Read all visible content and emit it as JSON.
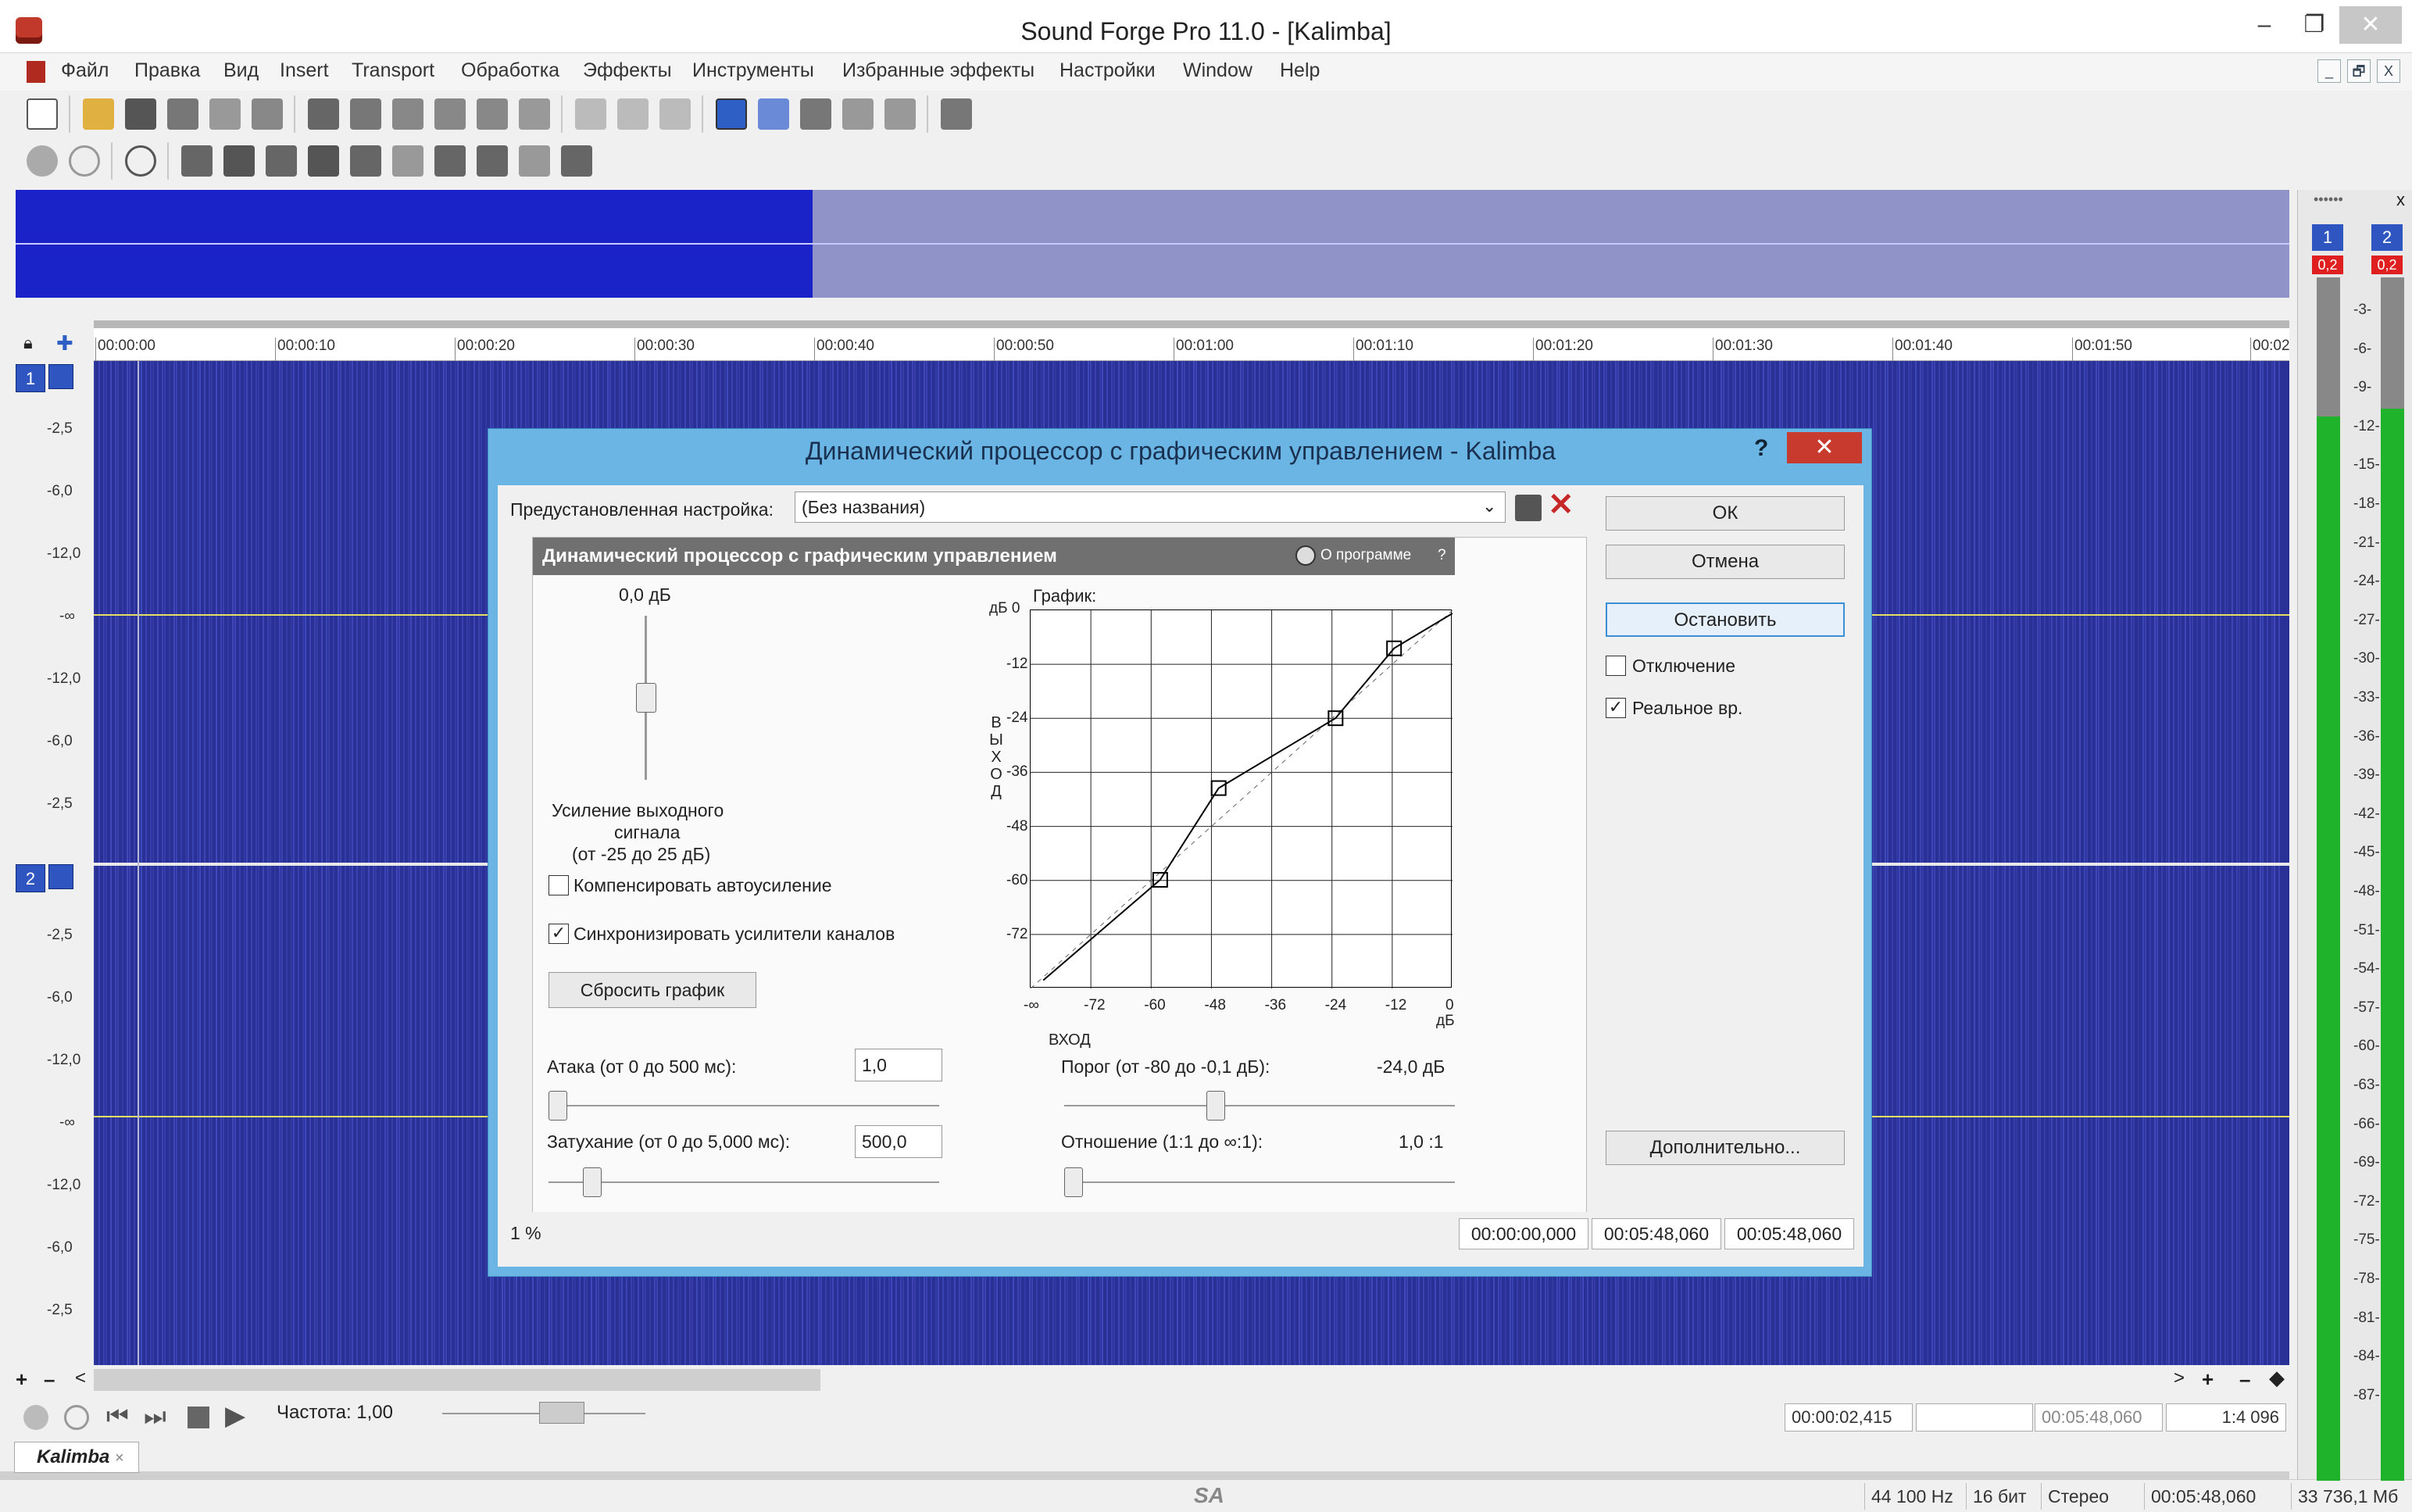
{
  "window": {
    "title": "Sound Forge Pro 11.0 - [Kalimba]",
    "minimize": "–",
    "restore": "❐",
    "close": "✕"
  },
  "menu": [
    "Файл",
    "Правка",
    "Вид",
    "Insert",
    "Transport",
    "Обработка",
    "Эффекты",
    "Инструменты",
    "Избранные эффекты",
    "Настройки",
    "Window",
    "Help"
  ],
  "mdi_buttons": [
    "_",
    "🗗",
    "X"
  ],
  "ruler": [
    "00:00:00",
    "00:00:10",
    "00:00:20",
    "00:00:30",
    "00:00:40",
    "00:00:50",
    "00:01:00",
    "00:01:10",
    "00:01:20",
    "00:01:30",
    "00:01:40",
    "00:01:50",
    "00:02"
  ],
  "channels": [
    {
      "badge": "1",
      "db_labels": [
        "-2,5",
        "-6,0",
        "-12,0",
        "-∞",
        "-12,0",
        "-6,0",
        "-2,5"
      ]
    },
    {
      "badge": "2",
      "db_labels": [
        "-2,5",
        "-6,0",
        "-12,0",
        "-∞",
        "-12,0",
        "-6,0",
        "-2,5"
      ]
    }
  ],
  "transport": {
    "rate_label": "Частота: 1,00"
  },
  "bottom_fields": {
    "position": "00:00:02,415",
    "length": "00:05:48,060",
    "zoom": "1:4 096"
  },
  "document_tab": {
    "name": "Kalimba",
    "close": "×"
  },
  "status": {
    "logo": "SA",
    "sample_rate": "44 100 Hz",
    "bits": "16 бит",
    "channels": "Стерео",
    "duration": "00:05:48,060",
    "size": "33 736,1 Мб"
  },
  "meter": {
    "ch1": "1",
    "ch2": "2",
    "peak1": "0,2",
    "peak2": "0,2",
    "close": "x",
    "scale": [
      "3",
      "6",
      "9",
      "12",
      "15",
      "18",
      "21",
      "24",
      "27",
      "30",
      "33",
      "36",
      "39",
      "42",
      "45",
      "48",
      "51",
      "54",
      "57",
      "60",
      "63",
      "66",
      "69",
      "72",
      "75",
      "78",
      "81",
      "84",
      "87"
    ]
  },
  "dialog": {
    "title": "Динамический процессор с графическим управлением - Kalimba",
    "help": "?",
    "close": "✕",
    "preset_label": "Предустановленная настройка:",
    "preset_value": "(Без названия)",
    "ok": "ОК",
    "cancel": "Отмена",
    "stop": "Остановить",
    "bypass": "Отключение",
    "realtime": "Реальное вр.",
    "more": "Дополнительно...",
    "progress": "1 %",
    "time_start": "00:00:00,000",
    "time_end": "00:05:48,060",
    "time_length": "00:05:48,060",
    "plugin": {
      "title": "Динамический процессор с графическим управлением",
      "about": "О программе",
      "about_q": "?",
      "gain_value": "0,0 дБ",
      "gain_label_1": "Усиление выходного",
      "gain_label_2": "сигнала",
      "gain_label_3": "(от -25 до 25 дБ)",
      "auto_gain": "Компенсировать автоусиление",
      "sync_gain": "Синхронизировать усилители каналов",
      "reset": "Сбросить график",
      "graph_label": "График:",
      "y_unit": "дБ 0",
      "y_ticks": [
        "-12",
        "-24",
        "-36",
        "-48",
        "-60",
        "-72"
      ],
      "x_ticks": [
        "-∞",
        "-72",
        "-60",
        "-48",
        "-36",
        "-24",
        "-12",
        "0"
      ],
      "x_unit": "дБ",
      "x_title": "ВХОД",
      "y_title": "В Ы Х О Д",
      "attack_label": "Атака (от 0 до 500 мс):",
      "attack_value": "1,0",
      "release_label": "Затухание (от 0 до 5,000 мс):",
      "release_value": "500,0",
      "threshold_label": "Порог (от -80 до -0,1 дБ):",
      "threshold_value": "-24,0 дБ",
      "ratio_label": "Отношение (1:1 до ∞:1):",
      "ratio_value": "1,0 :1"
    }
  }
}
